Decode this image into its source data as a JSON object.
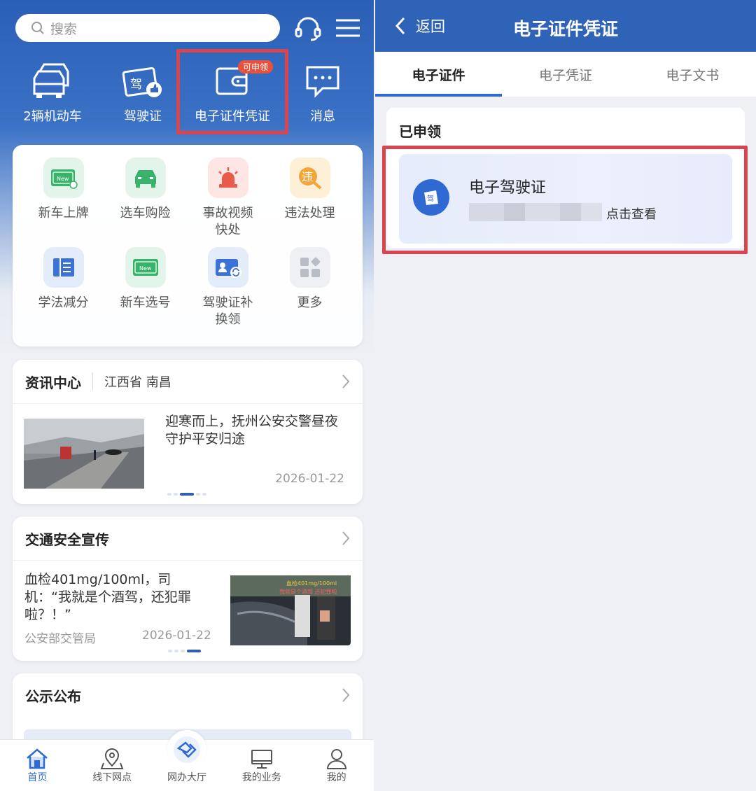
{
  "left": {
    "search": {
      "placeholder": "搜索"
    },
    "quick_items": [
      {
        "label": "2辆机动车"
      },
      {
        "label": "驾驶证"
      },
      {
        "label": "电子证件凭证",
        "badge": "可申领"
      },
      {
        "label": "消息"
      }
    ],
    "services": [
      {
        "label": "新车上牌",
        "icon": "new-plate-icon"
      },
      {
        "label": "选车购险",
        "icon": "car-insurance-icon"
      },
      {
        "label": "事故视频快处",
        "icon": "alarm-light-icon"
      },
      {
        "label": "违法处理",
        "icon": "violation-icon",
        "glyph": "违"
      },
      {
        "label": "学法减分",
        "icon": "book-icon"
      },
      {
        "label": "新车选号",
        "icon": "new-number-icon"
      },
      {
        "label": "驾驶证补换领",
        "icon": "license-renew-icon"
      },
      {
        "label": "更多",
        "icon": "more-grid-icon"
      }
    ],
    "news": {
      "title": "资讯中心",
      "location": "江西省 南昌",
      "headline": "迎寒而上，抚州公安交警昼夜守护平安归途",
      "date": "2026-01-22"
    },
    "safety": {
      "title": "交通安全宣传",
      "headline": "血检401mg/100ml，司机：“我就是个酒驾，还犯罪啦？！”",
      "source": "公安部交管局",
      "date": "2026-01-22",
      "thumb_caption": "血检401mg/100ml，司机：我就是个酒驾，还犯罪啦"
    },
    "notice": {
      "title": "公示公布"
    },
    "tabbar": [
      {
        "label": "首页",
        "active": true
      },
      {
        "label": "线下网点"
      },
      {
        "label": "网办大厅"
      },
      {
        "label": "我的业务"
      },
      {
        "label": "我的"
      }
    ]
  },
  "right": {
    "back_label": "返回",
    "title": "电子证件凭证",
    "tabs": [
      {
        "label": "电子证件",
        "active": true
      },
      {
        "label": "电子凭证"
      },
      {
        "label": "电子文书"
      }
    ],
    "section_title": "已申领",
    "card": {
      "title": "电子驾驶证",
      "action": "点击查看",
      "icon_glyph": "驾"
    }
  },
  "colors": {
    "primary": "#2f63b8",
    "highlight": "#d9454e",
    "accent": "#2e6ad1"
  }
}
